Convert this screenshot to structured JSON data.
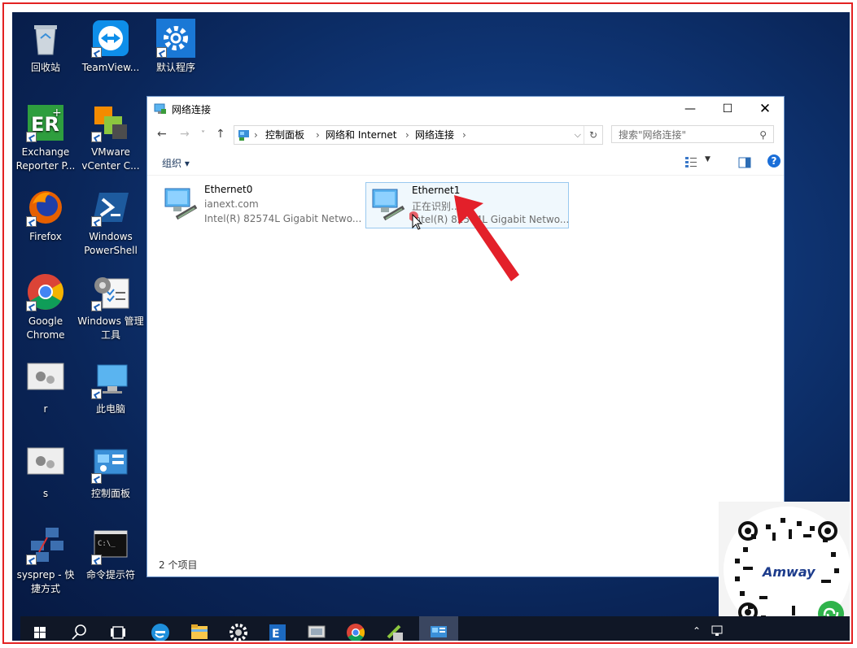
{
  "desktop": {
    "icons": [
      {
        "label": "回收站",
        "icon": "recycle-bin-icon"
      },
      {
        "label": "TeamView...",
        "icon": "teamviewer-icon"
      },
      {
        "label": "默认程序",
        "icon": "default-programs-icon"
      },
      {
        "label": "Exchange Reporter P...",
        "icon": "exchange-reporter-icon"
      },
      {
        "label": "VMware vCenter C...",
        "icon": "vmware-vcenter-icon"
      },
      {
        "label": "Firefox",
        "icon": "firefox-icon"
      },
      {
        "label": "Windows PowerShell",
        "icon": "powershell-icon"
      },
      {
        "label": "Google Chrome",
        "icon": "chrome-icon"
      },
      {
        "label": "Windows 管理工具",
        "icon": "admin-tools-icon"
      },
      {
        "label": "r",
        "icon": "settings-window-icon"
      },
      {
        "label": "此电脑",
        "icon": "this-pc-icon"
      },
      {
        "label": "s",
        "icon": "settings-window-icon"
      },
      {
        "label": "控制面板",
        "icon": "control-panel-icon"
      },
      {
        "label": "sysprep - 快捷方式",
        "icon": "sysprep-network-icon"
      },
      {
        "label": "命令提示符",
        "icon": "cmd-icon"
      }
    ]
  },
  "window": {
    "title": "网络连接",
    "address": {
      "crumbs": [
        "控制面板",
        "网络和 Internet",
        "网络连接"
      ]
    },
    "search_placeholder": "搜索\"网络连接\"",
    "organize_label": "组织 ▾",
    "items": [
      {
        "name": "Ethernet0",
        "status": "ianext.com",
        "device": "Intel(R) 82574L Gigabit Netwo..."
      },
      {
        "name": "Ethernet1",
        "status": "正在识别...",
        "device": "Intel(R) 82574L Gigabit Netwo..."
      }
    ],
    "status": "2 个项目"
  },
  "overlay": {
    "brand": "Amway",
    "annotation_color": "#e3202a"
  },
  "colors": {
    "frame": "#e32222",
    "desktop": "#0f3676",
    "taskbar": "#101726",
    "selection": "#99c9ef"
  }
}
